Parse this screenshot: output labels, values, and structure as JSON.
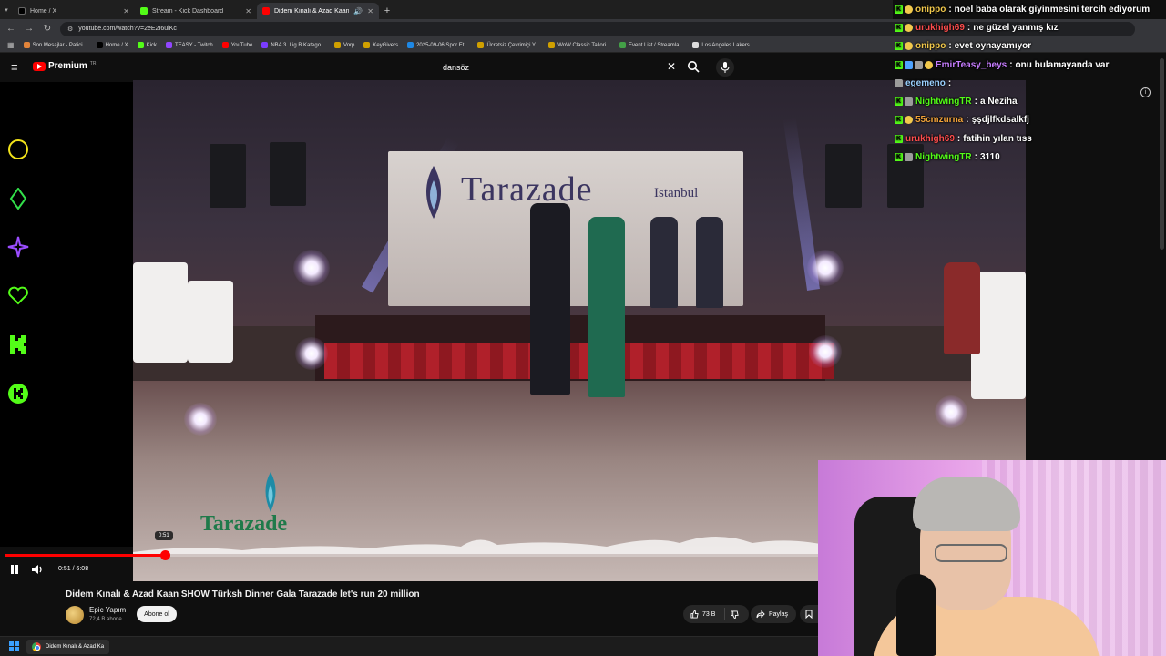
{
  "browser": {
    "tabs": [
      {
        "title": "Home / X",
        "fav_color": "#000000",
        "active": false
      },
      {
        "title": "Stream - Kick Dashboard",
        "fav_color": "#53fc18",
        "active": false
      },
      {
        "title": "Didem Kınalı & Azad Kaan",
        "fav_color": "#ff0000",
        "active": true
      }
    ],
    "url": "youtube.com/watch?v=2eE2I6uiKc",
    "bookmarks": [
      {
        "label": "Son Mesajlar - Patici...",
        "color": "#e2843a"
      },
      {
        "label": "Home / X",
        "color": "#000000"
      },
      {
        "label": "Kick",
        "color": "#53fc18"
      },
      {
        "label": "TEASY - Twitch",
        "color": "#9146ff"
      },
      {
        "label": "YouTube",
        "color": "#ff0000"
      },
      {
        "label": "NBA 3. Lig B Katego...",
        "color": "#7a3cff"
      },
      {
        "label": "Vorp",
        "color": "#d0a000"
      },
      {
        "label": "KeyGivers",
        "color": "#d0a000"
      },
      {
        "label": "2025-09-06 Spor Et...",
        "color": "#1e88e5"
      },
      {
        "label": "Ücretsiz Çevrimiçi Y...",
        "color": "#d0a000"
      },
      {
        "label": "WoW Classic Tailori...",
        "color": "#d0a000"
      },
      {
        "label": "Event List / Streamla...",
        "color": "#43a047"
      },
      {
        "label": "Los Angeles Lakers...",
        "color": "#dddddd"
      }
    ]
  },
  "youtube": {
    "logo_text": "Premium",
    "logo_sup": "TR",
    "search_query": "dansöz"
  },
  "player": {
    "progress_fraction": 0.1957,
    "current_time": "0:51",
    "duration": "6:08",
    "time_display": "0:51 / 6:08",
    "hover_time": "0:51"
  },
  "video_scene": {
    "banner_text": "Tarazade",
    "banner_sub": "Istanbul",
    "watermark_text": "Tarazade"
  },
  "video": {
    "title": "Didem Kınalı & Azad Kaan SHOW Türksh Dinner Gala Tarazade let's run 20 million",
    "channel_name": "Epic Yapım",
    "subscribers": "72,4 B abone",
    "subscribe_label": "Abone ol",
    "likes": "73 B",
    "share_label": "Paylaş"
  },
  "chat": [
    {
      "user": "onippo",
      "user_color": "#f2c94c",
      "message": "noel baba olarak giyinmesini tercih ediyorum",
      "badges": [
        "kick",
        "emoji"
      ]
    },
    {
      "user": "urukhigh69",
      "user_color": "#ff4d4d",
      "message": "ne güzel yanmış kız",
      "badges": [
        "kick",
        "emoji"
      ]
    },
    {
      "user": "onippo",
      "user_color": "#f2c94c",
      "message": "evet oynayamıyor",
      "badges": [
        "kick",
        "emoji"
      ]
    },
    {
      "user": "EmirTeasy_beys",
      "user_color": "#c77dff",
      "message": "onu bulamayanda var",
      "badges": [
        "kick",
        "blue",
        "sub",
        "emoji"
      ]
    },
    {
      "user": "egemeno",
      "user_color": "#9ad0ff",
      "message": "",
      "badges": [
        "sub"
      ]
    },
    {
      "user": "NightwingTR",
      "user_color": "#53fc18",
      "message": "a Neziha",
      "badges": [
        "kick",
        "sub"
      ]
    },
    {
      "user": "55cmzurna",
      "user_color": "#f2a33a",
      "message": "şşdjlfkdsalkfj",
      "badges": [
        "kick",
        "emoji"
      ]
    },
    {
      "user": "urukhigh69",
      "user_color": "#ff4d4d",
      "message": "fatihin yılan tıss",
      "badges": [
        "kick"
      ]
    },
    {
      "user": "NightwingTR",
      "user_color": "#53fc18",
      "message": "3110",
      "badges": [
        "kick",
        "sub"
      ]
    }
  ],
  "taskbar": {
    "app_label": "Didem Kınalı & Azad Ka"
  },
  "colors": {
    "accent_red": "#ff0000",
    "kick_green": "#53fc18"
  }
}
